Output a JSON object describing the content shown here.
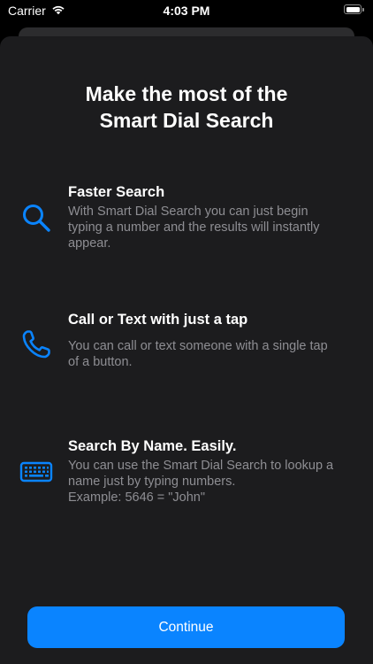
{
  "status_bar": {
    "carrier": "Carrier",
    "time": "4:03 PM",
    "icons": [
      "wifi-icon",
      "battery-icon"
    ]
  },
  "sheet": {
    "title": "Make the most of the\nSmart Dial Search",
    "features": [
      {
        "icon": "search-icon",
        "title": "Faster Search",
        "description": "With Smart Dial Search you can just begin\ntyping a number and the results will instantly\nappear."
      },
      {
        "icon": "phone-icon",
        "title": "Call or Text with just a tap",
        "description": "You can call or text someone with a single tap\nof a button."
      },
      {
        "icon": "keyboard-icon",
        "title": "Search By Name. Easily.",
        "description": "You can use the Smart Dial Search to lookup a\nname just by typing numbers.\nExample: 5646 = \"John\""
      }
    ],
    "continue_label": "Continue"
  },
  "colors": {
    "accent": "#0a84ff",
    "sheet_background": "#1c1c1e",
    "secondary_text": "#8e8e93"
  }
}
